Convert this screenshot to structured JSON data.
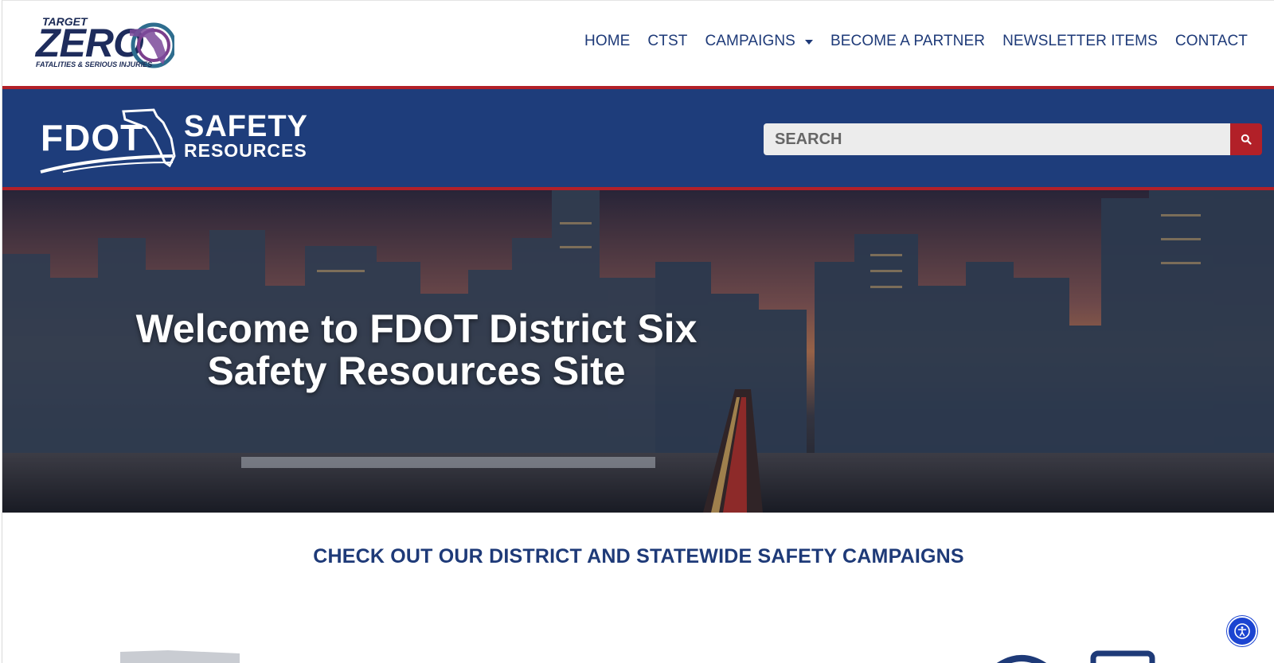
{
  "header": {
    "logo": {
      "target_text": "TARGET",
      "zero_text": "ZERO",
      "subtitle": "FATALITIES & SERIOUS INJURIES"
    },
    "nav": [
      {
        "label": "HOME"
      },
      {
        "label": "CTST"
      },
      {
        "label": "CAMPAIGNS",
        "has_dropdown": true
      },
      {
        "label": "BECOME A PARTNER"
      },
      {
        "label": "NEWSLETTER ITEMS"
      },
      {
        "label": "CONTACT"
      }
    ]
  },
  "band": {
    "logo": {
      "fdot": "FDOT",
      "safety": "SAFETY",
      "resources": "RESOURCES"
    },
    "search": {
      "placeholder": "SEARCH"
    }
  },
  "hero": {
    "title_line1": "Welcome to FDOT District Six",
    "title_line2": "Safety Resources Site"
  },
  "campaigns": {
    "heading": "CHECK OUT OUR DISTRICT AND STATEWIDE SAFETY CAMPAIGNS"
  },
  "colors": {
    "navy": "#1e3a78",
    "band_blue": "#1e3d7b",
    "accent_red": "#b22028",
    "accessibility_blue": "#1b44d1"
  },
  "icons": {
    "search": "search-icon",
    "dropdown": "caret-down-icon",
    "accessibility": "accessibility-icon"
  }
}
